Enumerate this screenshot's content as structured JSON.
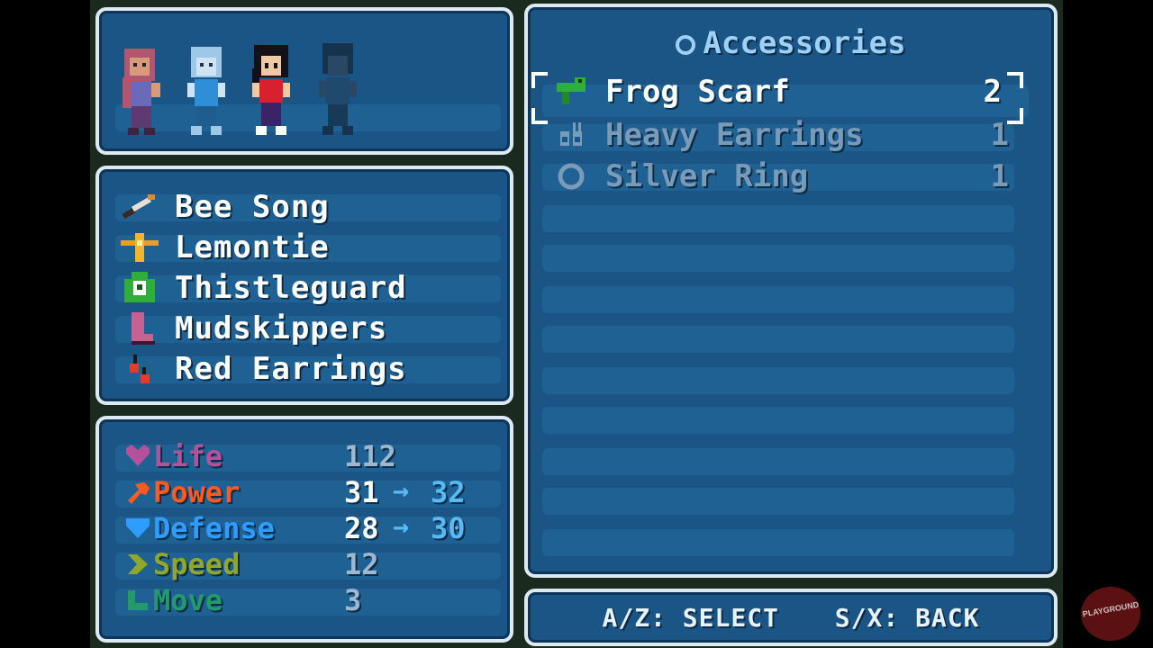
{
  "equipment": [
    {
      "label": "Bee Song",
      "icon": "flute-icon"
    },
    {
      "label": "Lemontie",
      "icon": "necktie-icon"
    },
    {
      "label": "Thistleguard",
      "icon": "armor-icon"
    },
    {
      "label": "Mudskippers",
      "icon": "boot-icon"
    },
    {
      "label": "Red Earrings",
      "icon": "earrings-icon"
    }
  ],
  "stats": [
    {
      "label": "Life",
      "value": "112",
      "color": "#b3529b",
      "icon": "heart-icon"
    },
    {
      "label": "Power",
      "value": "31",
      "next": "32",
      "color": "#ff5a1f",
      "icon": "fist-icon"
    },
    {
      "label": "Defense",
      "value": "28",
      "next": "30",
      "color": "#2f9cff",
      "icon": "shield-icon"
    },
    {
      "label": "Speed",
      "value": "12",
      "color": "#8ea72c",
      "icon": "chevron-icon"
    },
    {
      "label": "Move",
      "value": "3",
      "color": "#239a6b",
      "icon": "boot-icon"
    }
  ],
  "accessories": {
    "title": "Accessories",
    "items": [
      {
        "name": "Frog Scarf",
        "qty": "2",
        "selected": true,
        "icon": "frog-scarf-icon"
      },
      {
        "name": "Heavy Earrings",
        "qty": "1",
        "selected": false,
        "icon": "heavy-earrings-icon"
      },
      {
        "name": "Silver Ring",
        "qty": "1",
        "selected": false,
        "icon": "ring-icon"
      }
    ]
  },
  "controls": {
    "select": "A/Z: SELECT",
    "back": "S/X: BACK"
  },
  "arrow_glyph": "→",
  "watermark": "PLAYGROUND",
  "colors": {
    "panel": "#1b5586",
    "panel_border": "#dfe9f2",
    "highlight": "#59b9f3"
  }
}
